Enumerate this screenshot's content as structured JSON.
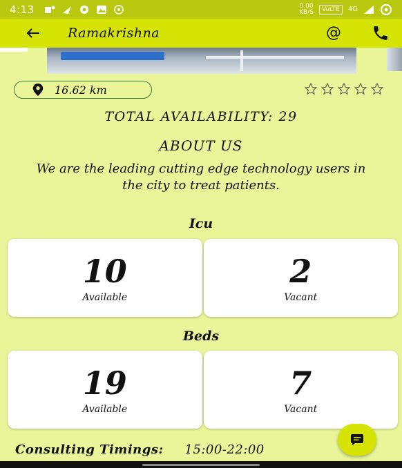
{
  "status_bar": {
    "time": "4:13",
    "speed_value": "0.00",
    "speed_unit": "KB/S",
    "volte": "VoLTE",
    "network": "4G"
  },
  "app_bar": {
    "title": "Ramakrishna",
    "at_symbol": "@"
  },
  "info": {
    "distance": "16.62 km",
    "rating_stars": 5,
    "total_availability": "TOTAL AVAILABILITY:  29"
  },
  "about": {
    "heading": "ABOUT US",
    "text": "We are the leading cutting edge technology users in the city to treat patients."
  },
  "icu": {
    "title": "Icu",
    "available_value": "10",
    "available_label": "Available",
    "vacant_value": "2",
    "vacant_label": "Vacant"
  },
  "beds": {
    "title": "Beds",
    "available_value": "19",
    "available_label": "Available",
    "vacant_value": "7",
    "vacant_label": "Vacant"
  },
  "consulting": {
    "label": "Consulting Timings:",
    "value": "15:00-22:00"
  },
  "colors": {
    "background": "#e9f598",
    "app_bar": "#d5e305",
    "status_bar": "#b9c70e"
  }
}
